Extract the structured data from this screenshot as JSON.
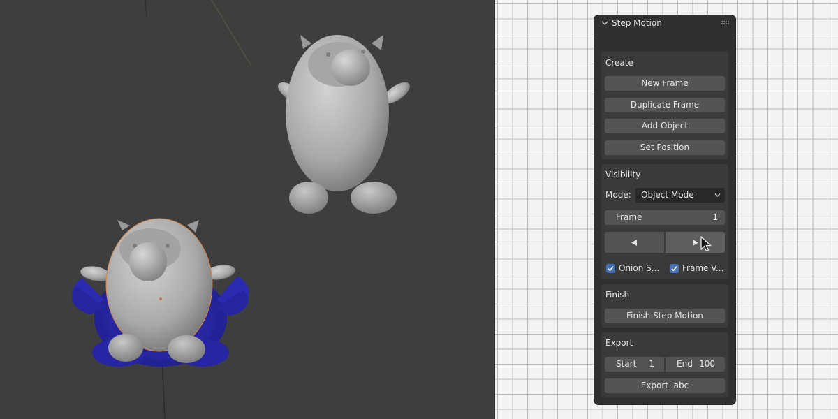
{
  "panel": {
    "title": "Step Motion",
    "icons": {
      "collapse": "chevron-down-icon",
      "grip": "drag-grip-icon"
    }
  },
  "create": {
    "title": "Create",
    "buttons": [
      "New Frame",
      "Duplicate Frame",
      "Add Object",
      "Set Position"
    ]
  },
  "visibility": {
    "title": "Visibility",
    "mode_label": "Mode:",
    "mode_value": "Object Mode",
    "frame_label": "Frame",
    "frame_value": "1",
    "onion_label": "Onion S...",
    "onion_checked": true,
    "frame_v_label": "Frame V...",
    "frame_v_checked": true
  },
  "finish": {
    "title": "Finish",
    "button": "Finish Step Motion"
  },
  "export": {
    "title": "Export",
    "start_label": "Start",
    "start_value": "1",
    "end_label": "End",
    "end_value": "100",
    "button": "Export .abc"
  },
  "colors": {
    "accent": "#4772b3",
    "viewport_bg": "#3e3e3e",
    "panel_bg": "#303030",
    "button_bg": "#545454",
    "onion_skin": "#2a2aa8"
  }
}
